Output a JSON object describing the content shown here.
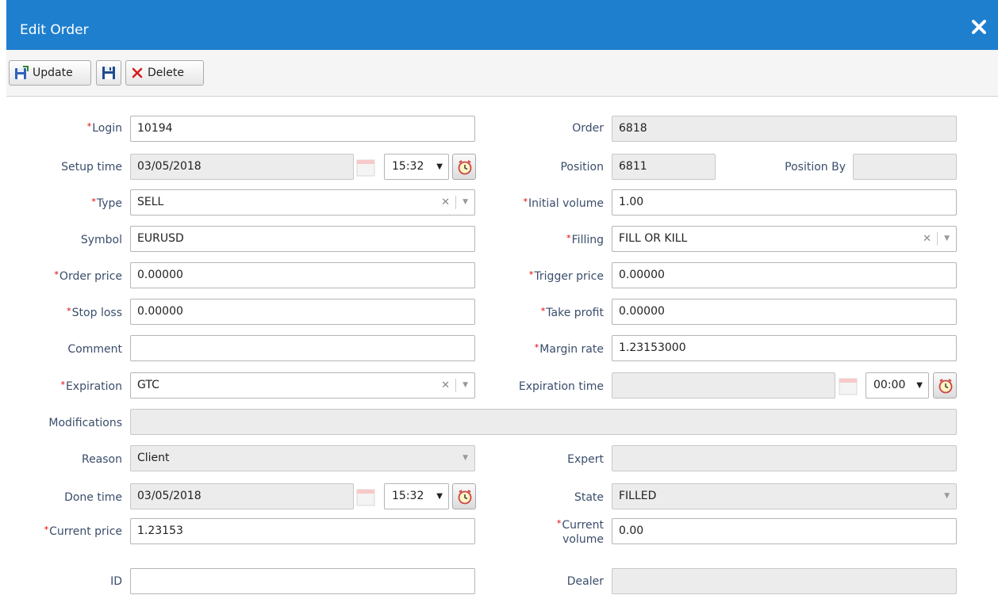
{
  "window": {
    "title": "Edit Order"
  },
  "toolbar": {
    "update_label": "Update",
    "delete_label": "Delete"
  },
  "form": {
    "login": {
      "label": "Login",
      "value": "10194"
    },
    "order": {
      "label": "Order",
      "value": "6818"
    },
    "setup_time": {
      "label": "Setup time",
      "date": "03/05/2018",
      "time": "15:32"
    },
    "position": {
      "label": "Position",
      "value": "6811"
    },
    "position_by": {
      "label": "Position By",
      "value": ""
    },
    "type": {
      "label": "Type",
      "value": "SELL"
    },
    "initial_volume": {
      "label": "Initial volume",
      "value": "1.00"
    },
    "symbol": {
      "label": "Symbol",
      "value": "EURUSD"
    },
    "filling": {
      "label": "Filling",
      "value": "FILL OR KILL"
    },
    "order_price": {
      "label": "Order price",
      "value": "0.00000"
    },
    "trigger_price": {
      "label": "Trigger price",
      "value": "0.00000"
    },
    "stop_loss": {
      "label": "Stop loss",
      "value": "0.00000"
    },
    "take_profit": {
      "label": "Take profit",
      "value": "0.00000"
    },
    "comment": {
      "label": "Comment",
      "value": ""
    },
    "margin_rate": {
      "label": "Margin rate",
      "value": "1.23153000"
    },
    "expiration": {
      "label": "Expiration",
      "value": "GTC"
    },
    "expiration_time": {
      "label": "Expiration time",
      "date": "",
      "time": "00:00"
    },
    "modifications": {
      "label": "Modifications",
      "value": ""
    },
    "reason": {
      "label": "Reason",
      "value": "Client"
    },
    "expert": {
      "label": "Expert",
      "value": ""
    },
    "done_time": {
      "label": "Done time",
      "date": "03/05/2018",
      "time": "15:32"
    },
    "state": {
      "label": "State",
      "value": "FILLED"
    },
    "current_price": {
      "label": "Current price",
      "value": "1.23153"
    },
    "current_volume": {
      "label_line1": "Current",
      "label_line2": "volume",
      "value": "0.00"
    },
    "id": {
      "label": "ID",
      "value": ""
    },
    "dealer": {
      "label": "Dealer",
      "value": ""
    }
  },
  "colors": {
    "header": "#1f7fcf",
    "label": "#3a4d6b",
    "required": "#d00000",
    "readonly_bg": "#ececec"
  },
  "icons": [
    "close-icon",
    "save-update-icon",
    "floppy-icon",
    "delete-x-icon",
    "calendar-icon",
    "clock-icon"
  ]
}
